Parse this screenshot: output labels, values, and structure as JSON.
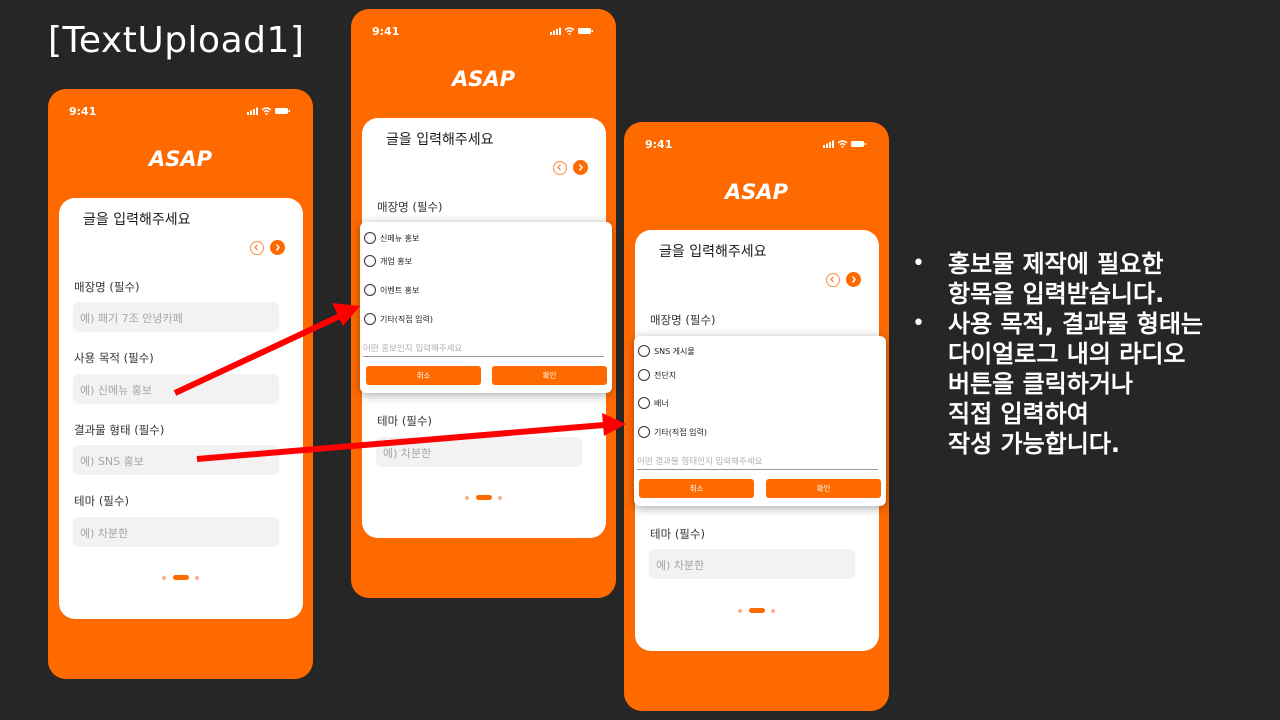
{
  "slide": {
    "title": "[TextUpload1]"
  },
  "phone": {
    "time": "9:41",
    "brand": "ASAP",
    "card_title": "글을 입력해주세요",
    "fields": [
      {
        "label": "매장명 (필수)",
        "placeholder": "예) 패기 7조 안녕카페"
      },
      {
        "label": "사용 목적 (필수)",
        "placeholder": "예) 신메뉴 홍보"
      },
      {
        "label": "결과물 형태 (필수)",
        "placeholder": "예) SNS 홍보"
      },
      {
        "label": "테마 (필수)",
        "placeholder": "예) 차분한"
      }
    ]
  },
  "dialog_purpose": {
    "options": [
      "신메뉴 홍보",
      "개업 홍보",
      "이벤트 홍보",
      "기타(직접 입력)"
    ],
    "input_placeholder": "어떤 홍보인지 입력해주세요",
    "cancel": "취소",
    "confirm": "확인"
  },
  "dialog_format": {
    "options": [
      "SNS 게시물",
      "전단지",
      "배너",
      "기타(직접 입력)"
    ],
    "input_placeholder": "어떤 결과물 형태인지 입력해주세요",
    "cancel": "취소",
    "confirm": "확인"
  },
  "bullets": [
    {
      "lines": [
        "홍보물 제작에 필요한",
        "항목을 입력받습니다."
      ]
    },
    {
      "lines": [
        "사용 목적, 결과물 형태는",
        "다이얼로그 내의 라디오",
        "버튼을 클릭하거나",
        "직접 입력하여",
        "작성 가능합니다."
      ]
    }
  ],
  "colors": {
    "accent": "#ff6a00",
    "background": "#262626",
    "arrow": "#ff0000"
  }
}
